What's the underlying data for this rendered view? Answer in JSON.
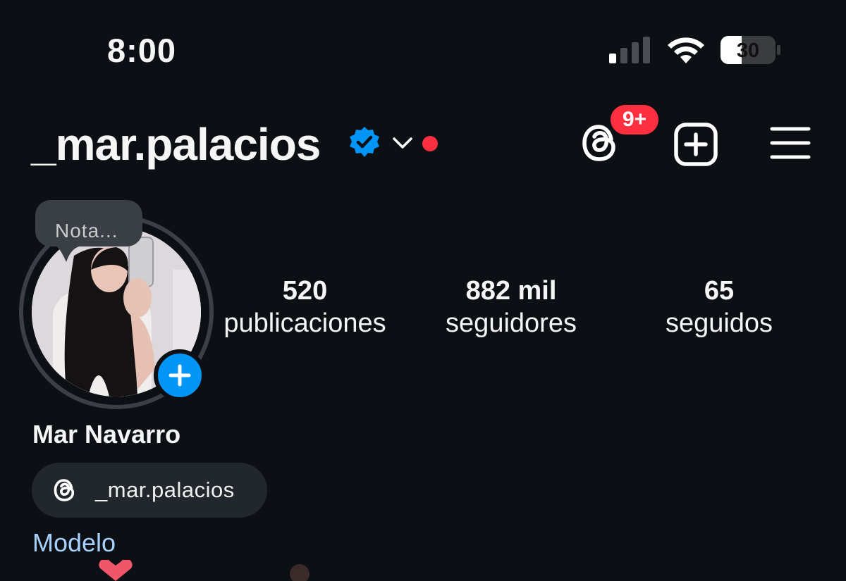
{
  "status_bar": {
    "time": "8:00",
    "battery_level": "30",
    "signal_bars_active": 1,
    "signal_bars_total": 4
  },
  "header": {
    "username": "_mar.palacios",
    "verified": true,
    "threads_badge": "9+",
    "accent_color": "#0095f6",
    "alert_color": "#ff2f40"
  },
  "profile": {
    "note_placeholder": "Nota...",
    "stats": [
      {
        "value": "520",
        "label": "publicaciones"
      },
      {
        "value": "882 mil",
        "label": "seguidores"
      },
      {
        "value": "65",
        "label": "seguidos"
      }
    ],
    "full_name": "Mar Navarro",
    "threads_handle": "_mar.palacios",
    "category": "Modelo"
  },
  "icons": [
    "signal-icon",
    "wifi-icon",
    "battery-icon",
    "verified-icon",
    "chevron-down-icon",
    "threads-icon",
    "add-post-icon",
    "menu-icon",
    "add-story-icon"
  ]
}
